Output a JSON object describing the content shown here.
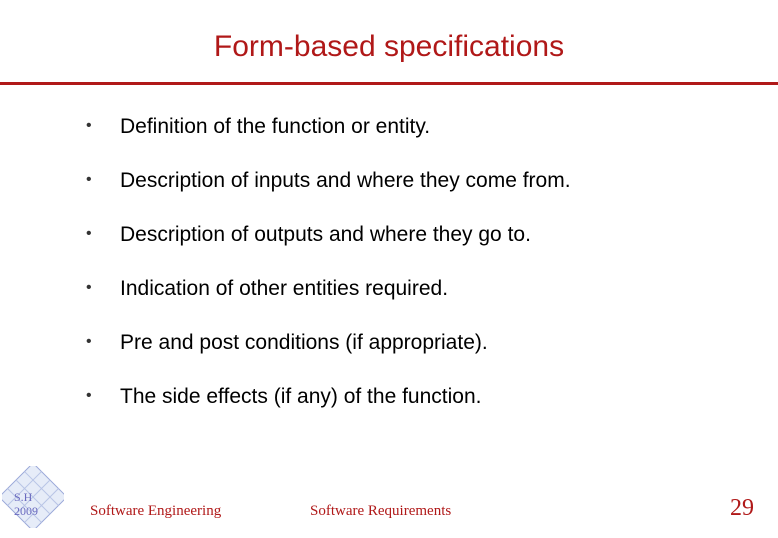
{
  "title": "Form-based specifications",
  "bullets": [
    "Definition of the function or entity.",
    "Description of inputs and where they come from.",
    "Description of outputs and where they go to.",
    "Indication of other entities required.",
    "Pre and post conditions (if appropriate).",
    "The side effects (if any) of the function."
  ],
  "footer": {
    "left": "Software Engineering",
    "center": "Software Requirements",
    "page": "29"
  },
  "logo": {
    "line1": "S.H",
    "line2": "2009"
  },
  "colors": {
    "accent": "#b01818",
    "logo_blue": "#6a6abf"
  }
}
